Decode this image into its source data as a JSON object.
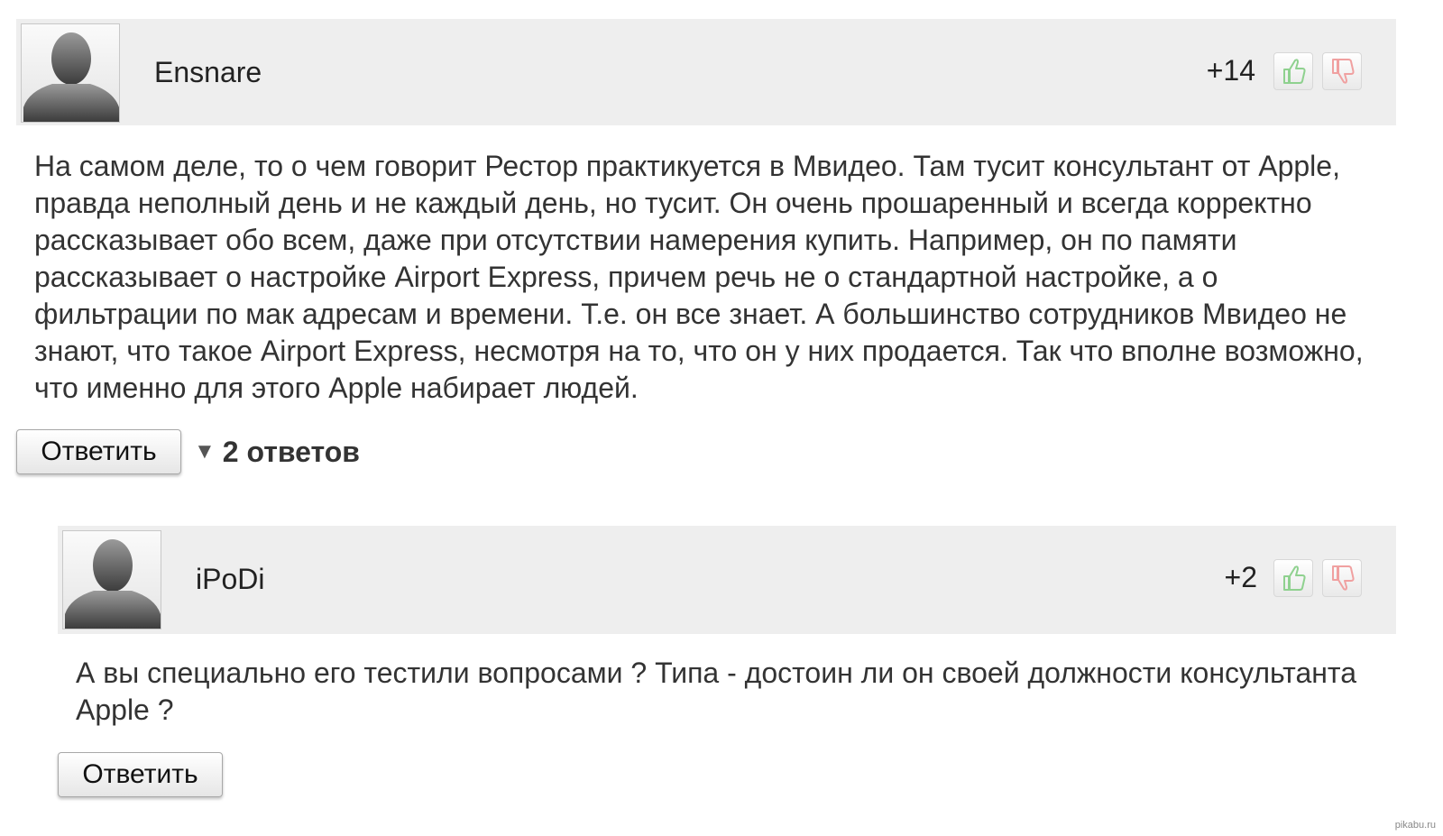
{
  "comments": [
    {
      "username": "Ensnare",
      "score": "+14",
      "text": "На самом деле, то о чем говорит Рестор практикуется в Мвидео. Там тусит консультант от Apple, правда неполный день и не каждый день, но тусит. Он очень прошаренный и всегда корректно рассказывает обо всем, даже при отсутствии намерения купить. Например, он по памяти рассказывает о настройке Airport Express, причем речь не о стандартной настройке, а о фильтрации по мак адресам и времени. Т.е. он все знает. А большинство сотрудников Мвидео не знают, что такое Airport Express, несмотря на то, что он у них продается. Так что вполне возможно, что именно для этого Apple набирает людей.",
      "reply_label": "Ответить",
      "replies_toggle": "2 ответов"
    },
    {
      "username": "iPoDi",
      "score": "+2",
      "text": "А вы специально его тестили вопросами ? Типа - достоин ли он своей должности консультанта Apple ?",
      "reply_label": "Ответить"
    }
  ],
  "icons": {
    "vote_up": "thumbs-up-icon",
    "vote_down": "thumbs-down-icon",
    "avatar": "default-avatar-icon",
    "toggle": "triangle-down-icon"
  },
  "colors": {
    "header_bg": "#eeeeee",
    "vote_up": "#8fd18f",
    "vote_down": "#f0a0a0"
  },
  "watermark": "pikabu.ru"
}
